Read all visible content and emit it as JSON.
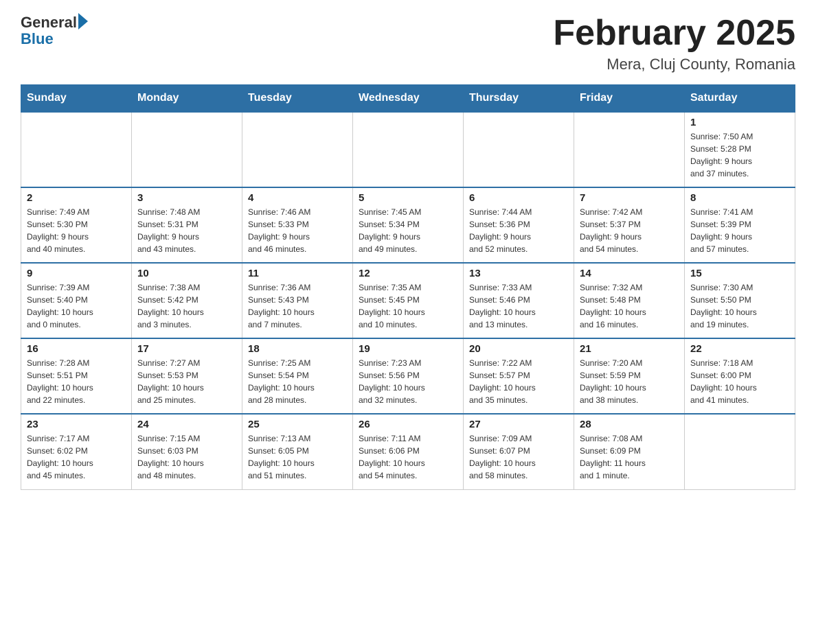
{
  "header": {
    "logo_general": "General",
    "logo_blue": "Blue",
    "month_title": "February 2025",
    "location": "Mera, Cluj County, Romania"
  },
  "weekdays": [
    "Sunday",
    "Monday",
    "Tuesday",
    "Wednesday",
    "Thursday",
    "Friday",
    "Saturday"
  ],
  "weeks": [
    [
      {
        "day": "",
        "info": ""
      },
      {
        "day": "",
        "info": ""
      },
      {
        "day": "",
        "info": ""
      },
      {
        "day": "",
        "info": ""
      },
      {
        "day": "",
        "info": ""
      },
      {
        "day": "",
        "info": ""
      },
      {
        "day": "1",
        "info": "Sunrise: 7:50 AM\nSunset: 5:28 PM\nDaylight: 9 hours\nand 37 minutes."
      }
    ],
    [
      {
        "day": "2",
        "info": "Sunrise: 7:49 AM\nSunset: 5:30 PM\nDaylight: 9 hours\nand 40 minutes."
      },
      {
        "day": "3",
        "info": "Sunrise: 7:48 AM\nSunset: 5:31 PM\nDaylight: 9 hours\nand 43 minutes."
      },
      {
        "day": "4",
        "info": "Sunrise: 7:46 AM\nSunset: 5:33 PM\nDaylight: 9 hours\nand 46 minutes."
      },
      {
        "day": "5",
        "info": "Sunrise: 7:45 AM\nSunset: 5:34 PM\nDaylight: 9 hours\nand 49 minutes."
      },
      {
        "day": "6",
        "info": "Sunrise: 7:44 AM\nSunset: 5:36 PM\nDaylight: 9 hours\nand 52 minutes."
      },
      {
        "day": "7",
        "info": "Sunrise: 7:42 AM\nSunset: 5:37 PM\nDaylight: 9 hours\nand 54 minutes."
      },
      {
        "day": "8",
        "info": "Sunrise: 7:41 AM\nSunset: 5:39 PM\nDaylight: 9 hours\nand 57 minutes."
      }
    ],
    [
      {
        "day": "9",
        "info": "Sunrise: 7:39 AM\nSunset: 5:40 PM\nDaylight: 10 hours\nand 0 minutes."
      },
      {
        "day": "10",
        "info": "Sunrise: 7:38 AM\nSunset: 5:42 PM\nDaylight: 10 hours\nand 3 minutes."
      },
      {
        "day": "11",
        "info": "Sunrise: 7:36 AM\nSunset: 5:43 PM\nDaylight: 10 hours\nand 7 minutes."
      },
      {
        "day": "12",
        "info": "Sunrise: 7:35 AM\nSunset: 5:45 PM\nDaylight: 10 hours\nand 10 minutes."
      },
      {
        "day": "13",
        "info": "Sunrise: 7:33 AM\nSunset: 5:46 PM\nDaylight: 10 hours\nand 13 minutes."
      },
      {
        "day": "14",
        "info": "Sunrise: 7:32 AM\nSunset: 5:48 PM\nDaylight: 10 hours\nand 16 minutes."
      },
      {
        "day": "15",
        "info": "Sunrise: 7:30 AM\nSunset: 5:50 PM\nDaylight: 10 hours\nand 19 minutes."
      }
    ],
    [
      {
        "day": "16",
        "info": "Sunrise: 7:28 AM\nSunset: 5:51 PM\nDaylight: 10 hours\nand 22 minutes."
      },
      {
        "day": "17",
        "info": "Sunrise: 7:27 AM\nSunset: 5:53 PM\nDaylight: 10 hours\nand 25 minutes."
      },
      {
        "day": "18",
        "info": "Sunrise: 7:25 AM\nSunset: 5:54 PM\nDaylight: 10 hours\nand 28 minutes."
      },
      {
        "day": "19",
        "info": "Sunrise: 7:23 AM\nSunset: 5:56 PM\nDaylight: 10 hours\nand 32 minutes."
      },
      {
        "day": "20",
        "info": "Sunrise: 7:22 AM\nSunset: 5:57 PM\nDaylight: 10 hours\nand 35 minutes."
      },
      {
        "day": "21",
        "info": "Sunrise: 7:20 AM\nSunset: 5:59 PM\nDaylight: 10 hours\nand 38 minutes."
      },
      {
        "day": "22",
        "info": "Sunrise: 7:18 AM\nSunset: 6:00 PM\nDaylight: 10 hours\nand 41 minutes."
      }
    ],
    [
      {
        "day": "23",
        "info": "Sunrise: 7:17 AM\nSunset: 6:02 PM\nDaylight: 10 hours\nand 45 minutes."
      },
      {
        "day": "24",
        "info": "Sunrise: 7:15 AM\nSunset: 6:03 PM\nDaylight: 10 hours\nand 48 minutes."
      },
      {
        "day": "25",
        "info": "Sunrise: 7:13 AM\nSunset: 6:05 PM\nDaylight: 10 hours\nand 51 minutes."
      },
      {
        "day": "26",
        "info": "Sunrise: 7:11 AM\nSunset: 6:06 PM\nDaylight: 10 hours\nand 54 minutes."
      },
      {
        "day": "27",
        "info": "Sunrise: 7:09 AM\nSunset: 6:07 PM\nDaylight: 10 hours\nand 58 minutes."
      },
      {
        "day": "28",
        "info": "Sunrise: 7:08 AM\nSunset: 6:09 PM\nDaylight: 11 hours\nand 1 minute."
      },
      {
        "day": "",
        "info": ""
      }
    ]
  ]
}
